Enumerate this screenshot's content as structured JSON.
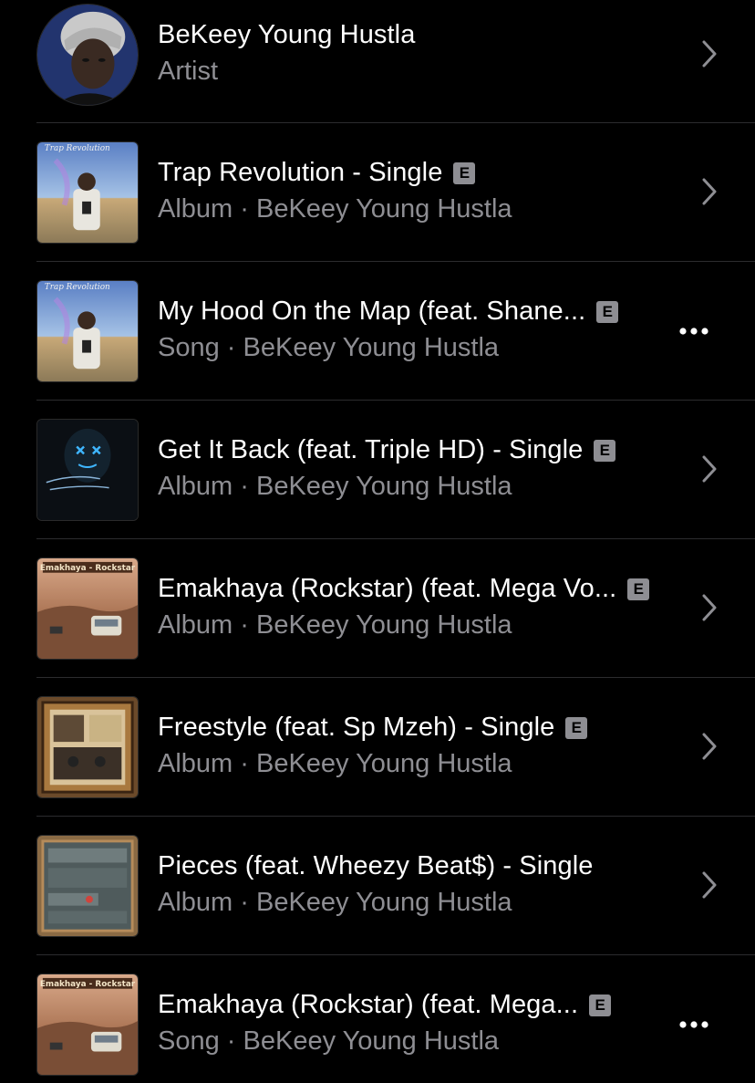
{
  "results": [
    {
      "title": "BeKeey Young Hustla",
      "subtitle": "Artist",
      "explicit": false,
      "action": "chevron",
      "art": "artist-portrait"
    },
    {
      "title": "Trap Revolution - Single",
      "subtitle": "Album · BeKeey Young Hustla",
      "explicit": true,
      "action": "chevron",
      "art": "trap-revolution-cover"
    },
    {
      "title": "My Hood On the Map (feat. Shane...",
      "subtitle": "Song · BeKeey Young Hustla",
      "explicit": true,
      "action": "more",
      "art": "trap-revolution-cover"
    },
    {
      "title": "Get It Back (feat. Triple HD) - Single",
      "subtitle": "Album · BeKeey Young Hustla",
      "explicit": true,
      "action": "chevron",
      "art": "get-it-back-cover"
    },
    {
      "title": "Emakhaya (Rockstar) (feat. Mega Vo...",
      "subtitle": "Album · BeKeey Young Hustla",
      "explicit": true,
      "action": "chevron",
      "art": "emakhaya-cover"
    },
    {
      "title": "Freestyle (feat. Sp Mzeh) - Single",
      "subtitle": "Album · BeKeey Young Hustla",
      "explicit": true,
      "action": "chevron",
      "art": "freestyle-cover"
    },
    {
      "title": "Pieces (feat. Wheezy Beat$) - Single",
      "subtitle": "Album · BeKeey Young Hustla",
      "explicit": false,
      "action": "chevron",
      "art": "pieces-cover"
    },
    {
      "title": "Emakhaya (Rockstar) (feat. Mega...",
      "subtitle": "Song · BeKeey Young Hustla",
      "explicit": true,
      "action": "more",
      "art": "emakhaya-cover"
    }
  ],
  "cover_text": {
    "trap_revolution": "Trap Revolution",
    "emakhaya": "Emakhaya - Rockstar"
  },
  "explicit_label": "E",
  "colors": {
    "background": "#000000",
    "title": "#ffffff",
    "subtitle": "#8e8e93",
    "divider": "#2c2c2e",
    "chevron": "#8e8e93",
    "explicit_badge": "#8e8e93"
  }
}
